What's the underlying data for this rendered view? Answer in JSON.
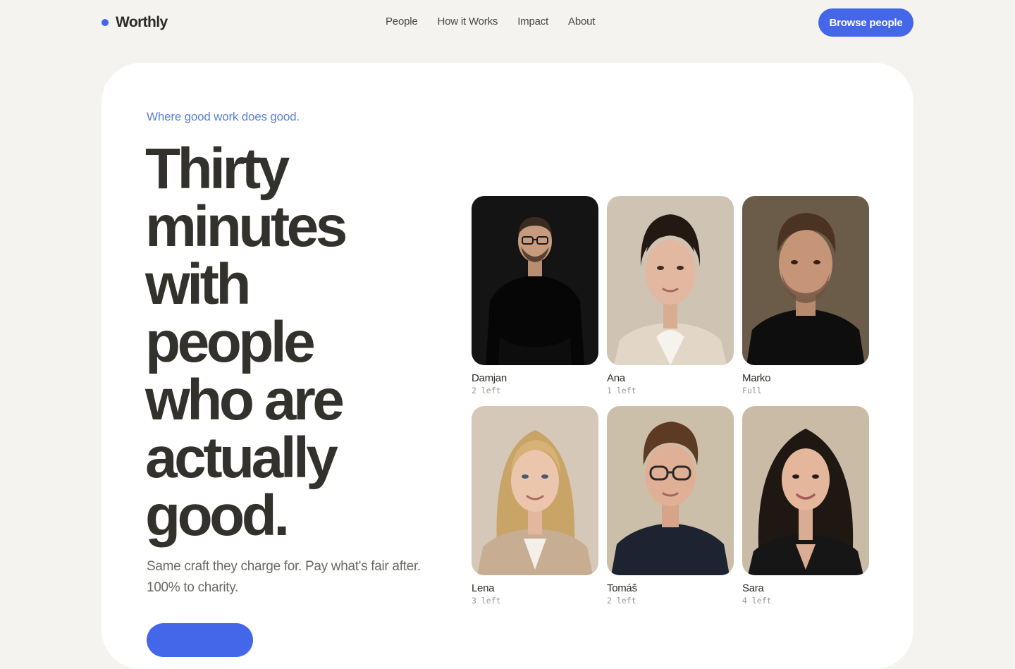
{
  "nav": {
    "brand": "Worthly",
    "links": [
      "People",
      "How it Works",
      "Impact",
      "About"
    ],
    "cta": "Browse people"
  },
  "hero": {
    "tagline": "Where good work does good.",
    "headline_lines": [
      "Thirty",
      "minutes",
      "with",
      "people",
      "who are",
      "actually",
      "good."
    ],
    "subtitle_lines": [
      "Same craft they charge for. Pay what's fair after.",
      "100% to charity."
    ],
    "cta": ""
  },
  "people": [
    {
      "name": "Damjan",
      "status": "2 left",
      "photo": "portrait-man-black-tshirt-glasses"
    },
    {
      "name": "Ana",
      "status": "1 left",
      "photo": "portrait-woman-beige-blazer"
    },
    {
      "name": "Marko",
      "status": "Full",
      "photo": "portrait-man-stubble-black-shirt"
    },
    {
      "name": "Lena",
      "status": "3 left",
      "photo": "portrait-woman-blonde-blazer"
    },
    {
      "name": "Tomáš",
      "status": "2 left",
      "photo": "portrait-man-glasses-navy-shirt"
    },
    {
      "name": "Sara",
      "status": "4 left",
      "photo": "portrait-woman-dark-curly-hair"
    }
  ],
  "colors": {
    "accent": "#4466e8",
    "background": "#f4f3ef",
    "card": "#ffffff",
    "tagline": "#5b82d6",
    "headline": "#33312c"
  }
}
